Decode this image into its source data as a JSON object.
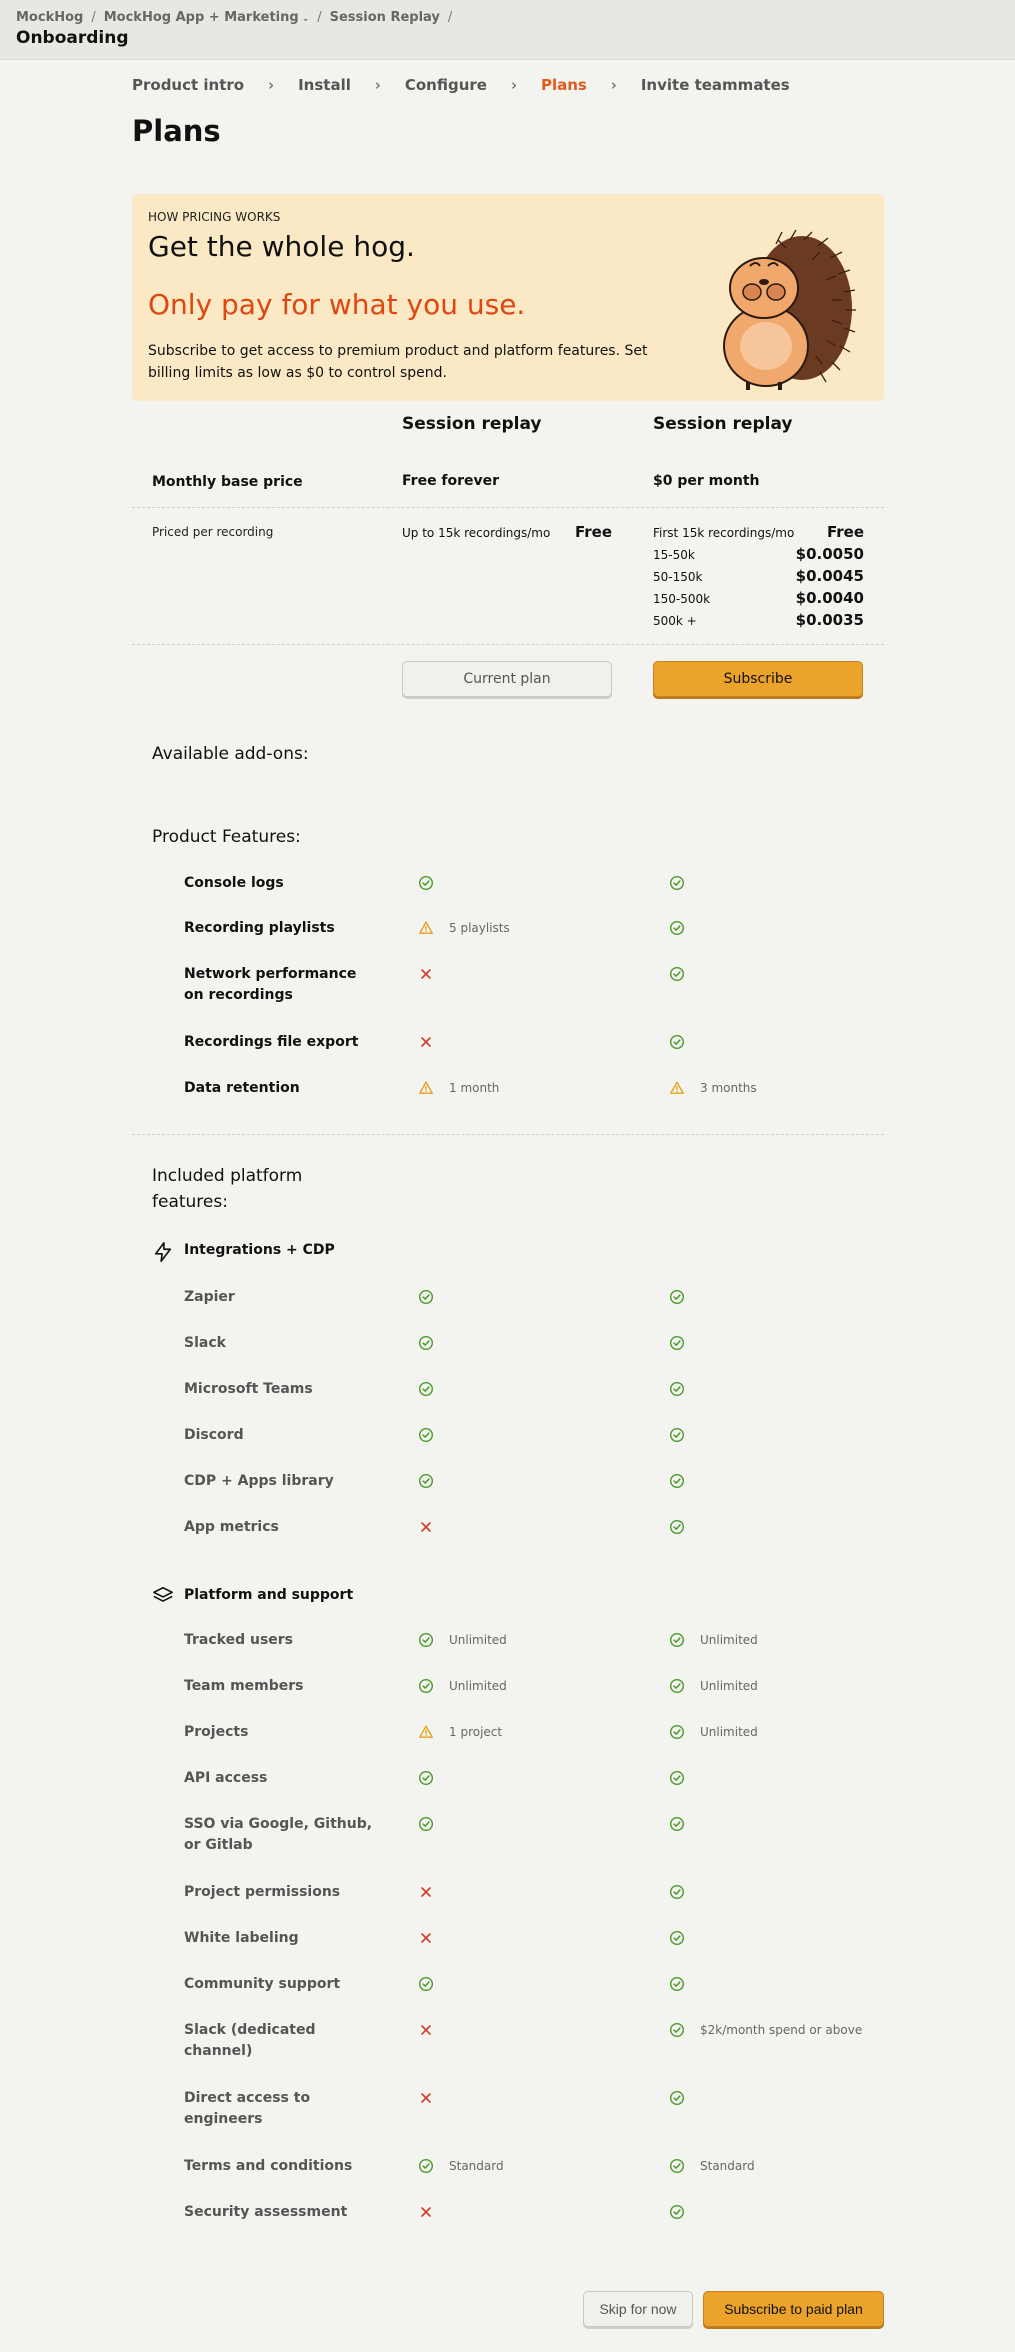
{
  "breadcrumb": {
    "org": "MockHog",
    "project": "MockHog App + Marketing",
    "section": "Session Replay"
  },
  "page_heading": "Onboarding",
  "steps": [
    "Product intro",
    "Install",
    "Configure",
    "Plans",
    "Invite teammates"
  ],
  "active_step": "Plans",
  "title": "Plans",
  "hero": {
    "kicker": "HOW PRICING WORKS",
    "headline": "Get the whole hog.",
    "subheadline": "Only pay for what you use.",
    "description": "Subscribe to get access to premium product and platform features. Set billing limits as low as $0 to control spend."
  },
  "plans": [
    {
      "name": "Session replay",
      "base_price": "Free forever",
      "button": "Current plan"
    },
    {
      "name": "Session replay",
      "base_price": "$0 per month",
      "button": "Subscribe"
    }
  ],
  "labels": {
    "monthly_base_price": "Monthly base price",
    "priced_per_recording": "Priced per recording",
    "available_addons": "Available add-ons:",
    "product_features": "Product Features:",
    "included_platform": "Included platform features:"
  },
  "free_pricing": {
    "desc": "Up to 15k recordings/mo",
    "amount": "Free"
  },
  "paid_tiers": [
    {
      "range": "First 15k recordings/mo",
      "amount": "Free"
    },
    {
      "range": "15-50k",
      "amount": "$0.0050"
    },
    {
      "range": "50-150k",
      "amount": "$0.0045"
    },
    {
      "range": "150-500k",
      "amount": "$0.0040"
    },
    {
      "range": "500k +",
      "amount": "$0.0035"
    }
  ],
  "product_features": [
    {
      "name": "Console logs",
      "free": "check",
      "free_note": "",
      "paid": "check",
      "paid_note": ""
    },
    {
      "name": "Recording playlists",
      "free": "warn",
      "free_note": "5 playlists",
      "paid": "check",
      "paid_note": ""
    },
    {
      "name": "Network performance on recordings",
      "free": "cross",
      "free_note": "",
      "paid": "check",
      "paid_note": ""
    },
    {
      "name": "Recordings file export",
      "free": "cross",
      "free_note": "",
      "paid": "check",
      "paid_note": ""
    },
    {
      "name": "Data retention",
      "free": "warn",
      "free_note": "1 month",
      "paid": "warn",
      "paid_note": "3 months"
    }
  ],
  "integrations": {
    "title": "Integrations + CDP",
    "icon": "lightning-icon",
    "items": [
      {
        "name": "Zapier",
        "free": "check",
        "free_note": "",
        "paid": "check",
        "paid_note": ""
      },
      {
        "name": "Slack",
        "free": "check",
        "free_note": "",
        "paid": "check",
        "paid_note": ""
      },
      {
        "name": "Microsoft Teams",
        "free": "check",
        "free_note": "",
        "paid": "check",
        "paid_note": ""
      },
      {
        "name": "Discord",
        "free": "check",
        "free_note": "",
        "paid": "check",
        "paid_note": ""
      },
      {
        "name": "CDP + Apps library",
        "free": "check",
        "free_note": "",
        "paid": "check",
        "paid_note": ""
      },
      {
        "name": "App metrics",
        "free": "cross",
        "free_note": "",
        "paid": "check",
        "paid_note": ""
      }
    ]
  },
  "platform": {
    "title": "Platform and support",
    "icon": "layers-icon",
    "items": [
      {
        "name": "Tracked users",
        "free": "check",
        "free_note": "Unlimited",
        "paid": "check",
        "paid_note": "Unlimited"
      },
      {
        "name": "Team members",
        "free": "check",
        "free_note": "Unlimited",
        "paid": "check",
        "paid_note": "Unlimited"
      },
      {
        "name": "Projects",
        "free": "warn",
        "free_note": "1 project",
        "paid": "check",
        "paid_note": "Unlimited"
      },
      {
        "name": "API access",
        "free": "check",
        "free_note": "",
        "paid": "check",
        "paid_note": ""
      },
      {
        "name": "SSO via Google, Github, or Gitlab",
        "free": "check",
        "free_note": "",
        "paid": "check",
        "paid_note": ""
      },
      {
        "name": "Project permissions",
        "free": "cross",
        "free_note": "",
        "paid": "check",
        "paid_note": ""
      },
      {
        "name": "White labeling",
        "free": "cross",
        "free_note": "",
        "paid": "check",
        "paid_note": ""
      },
      {
        "name": "Community support",
        "free": "check",
        "free_note": "",
        "paid": "check",
        "paid_note": ""
      },
      {
        "name": "Slack (dedicated channel)",
        "free": "cross",
        "free_note": "",
        "paid": "check",
        "paid_note": "$2k/month spend or above"
      },
      {
        "name": "Direct access to engineers",
        "free": "cross",
        "free_note": "",
        "paid": "check",
        "paid_note": ""
      },
      {
        "name": "Terms and conditions",
        "free": "check",
        "free_note": "Standard",
        "paid": "check",
        "paid_note": "Standard"
      },
      {
        "name": "Security assessment",
        "free": "cross",
        "free_note": "",
        "paid": "check",
        "paid_note": ""
      }
    ]
  },
  "footer": {
    "skip": "Skip for now",
    "subscribe": "Subscribe to paid plan"
  },
  "colors": {
    "accent": "#e35a1b",
    "check": "#4a9a2b",
    "cross": "#d23b27",
    "warn": "#e6a21c",
    "primary_button": "#eba32b",
    "hero_bg": "#fae9c4"
  }
}
